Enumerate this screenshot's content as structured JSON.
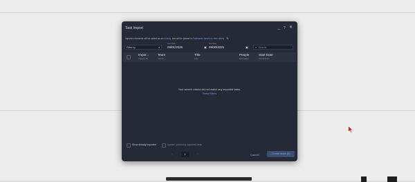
{
  "dialog": {
    "title": "Task Import",
    "subtitle_prefix": "Imported elements will be added as a/o ",
    "subtitle_link1": "Activity",
    "subtitle_mid": ", and will be placed in ",
    "subtitle_link2": "Swimlanes based on their labels",
    "minimize_icon": "minimize-icon",
    "help_icon": "help-icon",
    "close_icon": "close-icon"
  },
  "filters": {
    "filter_by": "Filter by",
    "start_date_label": "Start Date",
    "start_date": "09/01/2025",
    "end_date_label": "End Date",
    "end_date": "09/30/2025",
    "search_placeholder": "Search"
  },
  "table": {
    "columns": [
      {
        "label": "Impor...",
        "sub": "Imports ID"
      },
      {
        "label": "Team",
        "sub": "Teams"
      },
      {
        "label": "Title",
        "sub": "Title"
      },
      {
        "label": "People",
        "sub": "Estimation"
      },
      {
        "label": "Start Date",
        "sub": "Actual Start"
      }
    ]
  },
  "empty_state": {
    "message": "Your search criteria did not match any imported tasks.",
    "reset_link": "Reset filters"
  },
  "footer": {
    "show_imported": "Show already imported",
    "update_imported": "Update previously imported tasks",
    "page": "1",
    "cancel": "Cancel",
    "create": "Create tasks (0)"
  }
}
